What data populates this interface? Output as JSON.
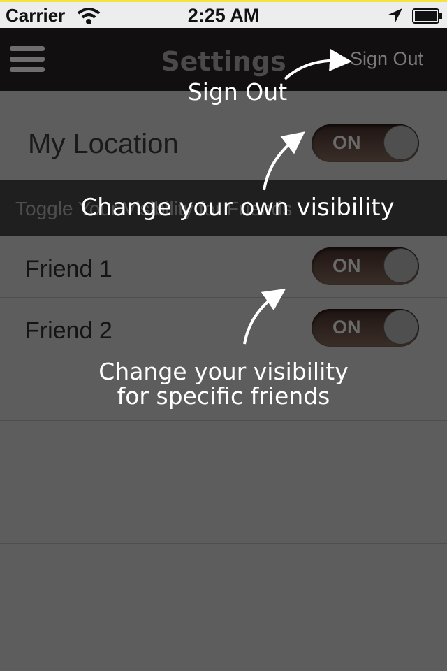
{
  "status_bar": {
    "carrier": "Carrier",
    "time": "2:25 AM",
    "wifi_icon": "wifi-icon",
    "location_icon": "location-arrow-icon",
    "battery_icon": "battery-icon"
  },
  "nav": {
    "menu_icon": "hamburger-menu-icon",
    "title": "Settings",
    "sign_out": "Sign Out"
  },
  "my_location": {
    "label": "My Location",
    "toggle": "ON",
    "state": "on"
  },
  "section_header": "Toggle Your Visibility for Friends",
  "friends": [
    {
      "label": "Friend 1",
      "toggle": "ON",
      "state": "on"
    },
    {
      "label": "Friend 2",
      "toggle": "ON",
      "state": "on"
    }
  ],
  "tips": {
    "sign_out": "Sign Out",
    "own_visibility": "Change your own visibility",
    "friends_visibility_line1": "Change your visibility",
    "friends_visibility_line2": "for specific friends"
  },
  "colors": {
    "nav_bg": "#120f10",
    "overlay_bg": "#5d5d5d",
    "status_accent": "#f4e33a",
    "tip_text": "#ffffff"
  }
}
